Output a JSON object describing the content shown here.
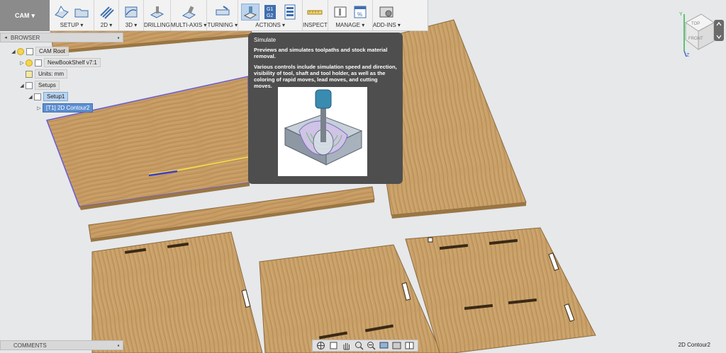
{
  "workspace": {
    "label": "CAM"
  },
  "toolbar": {
    "groups": [
      {
        "name": "setup",
        "label": "SETUP ▾"
      },
      {
        "name": "2d",
        "label": "2D ▾"
      },
      {
        "name": "3d",
        "label": "3D ▾"
      },
      {
        "name": "drilling",
        "label": "DRILLING"
      },
      {
        "name": "multi-axis",
        "label": "MULTI-AXIS ▾"
      },
      {
        "name": "turning",
        "label": "TURNING ▾"
      },
      {
        "name": "actions",
        "label": "ACTIONS ▾"
      },
      {
        "name": "inspect",
        "label": "INSPECT"
      },
      {
        "name": "manage",
        "label": "MANAGE ▾"
      },
      {
        "name": "add-ins",
        "label": "ADD-INS ▾"
      }
    ],
    "g1g2": {
      "g1": "G1",
      "g2": "G2"
    }
  },
  "browser": {
    "title": "BROWSER",
    "items": [
      {
        "label": "CAM Root"
      },
      {
        "label": "NewBookShelf v7:1"
      },
      {
        "label": "Units: mm"
      },
      {
        "label": "Setups"
      },
      {
        "label": "Setup1"
      },
      {
        "label": "[T1] 2D Contour2"
      }
    ]
  },
  "tooltip": {
    "title": "Simulate",
    "paragraph1": "Previews and simulates toolpaths and stock material removal.",
    "paragraph2": "Various controls include simulation speed and direction, visibility of tool, shaft and tool holder, as well as the coloring of rapid moves, lead moves, and cutting moves."
  },
  "comments": {
    "title": "COMMENTS"
  },
  "status": {
    "text": "2D Contour2"
  },
  "viewcube": {
    "top": "TOP",
    "front": "FRONT",
    "axis_y": "Y",
    "axis_z": "Z"
  },
  "colors": {
    "wood": "#c9a06a",
    "wood_dark": "#a9824d",
    "tooltip_bg": "#4e4e4e",
    "selection": "#b9d3f0",
    "toolpath": "#f2e34a"
  }
}
